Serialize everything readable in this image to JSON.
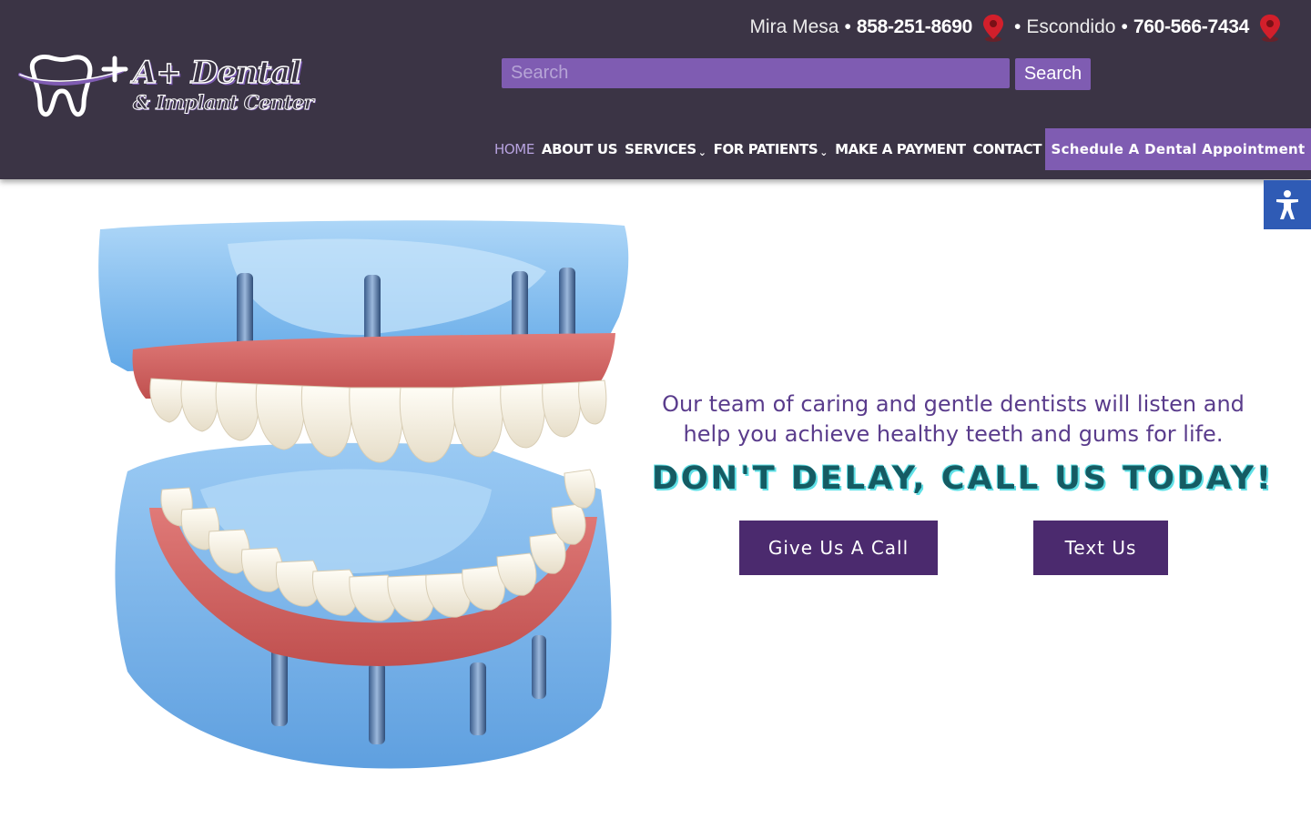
{
  "logo": {
    "title": "A+ Dental",
    "subtitle": "& Implant Center"
  },
  "topbar": {
    "location1": "Mira Mesa",
    "phone1": "858-251-8690",
    "location2": "Escondido",
    "phone2": "760-566-7434",
    "separator": "•",
    "pin_icon": "map-pin-icon"
  },
  "search": {
    "placeholder": "Search",
    "button_label": "Search"
  },
  "nav": {
    "items": [
      {
        "label": "HOME",
        "active": true
      },
      {
        "label": "ABOUT US"
      },
      {
        "label": "SERVICES",
        "dropdown": true
      },
      {
        "label": "FOR PATIENTS",
        "dropdown": true
      },
      {
        "label": "MAKE A PAYMENT"
      },
      {
        "label": "CONTACT",
        "dropdown": true
      }
    ],
    "chevron": "⌄",
    "cta_label": "Schedule A Dental Appointment"
  },
  "hero": {
    "text": "Our team of caring and gentle dentists will listen and help you achieve healthy teeth and gums for life.",
    "headline": "DON'T DELAY, CALL US TODAY!",
    "call_button": "Give Us A Call",
    "text_button": "Text Us"
  },
  "colors": {
    "header_bg": "#3b3445",
    "accent_purple": "#7f5cb2",
    "button_dark": "#4b2a6e",
    "hero_text": "#5a3c8c",
    "headline_teal": "#155b63",
    "a11y_blue": "#2f5bb5"
  }
}
